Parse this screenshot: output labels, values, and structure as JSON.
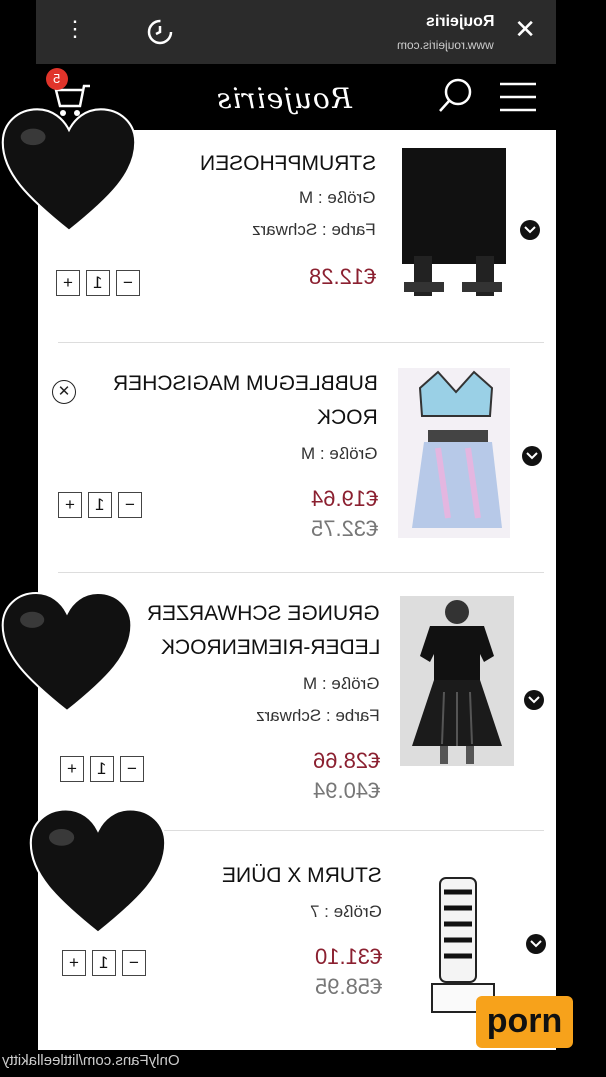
{
  "browser": {
    "title": "Roujeiris",
    "url": "www.roujeiris.com"
  },
  "site": {
    "logo": "Roujeiris",
    "cart_count": "5"
  },
  "items": [
    {
      "name_lines": [
        "STRUMPFHOSEN"
      ],
      "size_label": "Größe",
      "size": "M",
      "color_label": "Farbe",
      "color": "Schwarz",
      "price": "€12.28",
      "old_price": "",
      "quantity": "1"
    },
    {
      "name_lines": [
        "BUBBLEGUM MAGISCHER",
        "ROCK"
      ],
      "size_label": "Größe",
      "size": "M",
      "color_label": "",
      "color": "",
      "price": "€19.64",
      "old_price": "€32.75",
      "quantity": "1"
    },
    {
      "name_lines": [
        "GRUNGE SCHWARZER",
        "LEDER-RIEMENROCK"
      ],
      "size_label": "Größe",
      "size": "M",
      "color_label": "Farbe",
      "color": "Schwarz",
      "price": "€28.66",
      "old_price": "€40.94",
      "quantity": "1"
    },
    {
      "name_lines": [
        "STURM X DÜNE"
      ],
      "size_label": "Größe",
      "size": "7",
      "color_label": "",
      "color": "",
      "price": "€31.10",
      "old_price": "€58.95",
      "quantity": "1"
    }
  ],
  "qty_controls": {
    "plus": "+",
    "minus": "−"
  },
  "overlay": {
    "watermark": "OnlyFans.com/littleellakitty",
    "badge": "porn"
  },
  "colors": {
    "price": "#8b2030",
    "heart": "#111111",
    "badge": "#f7a21b"
  }
}
